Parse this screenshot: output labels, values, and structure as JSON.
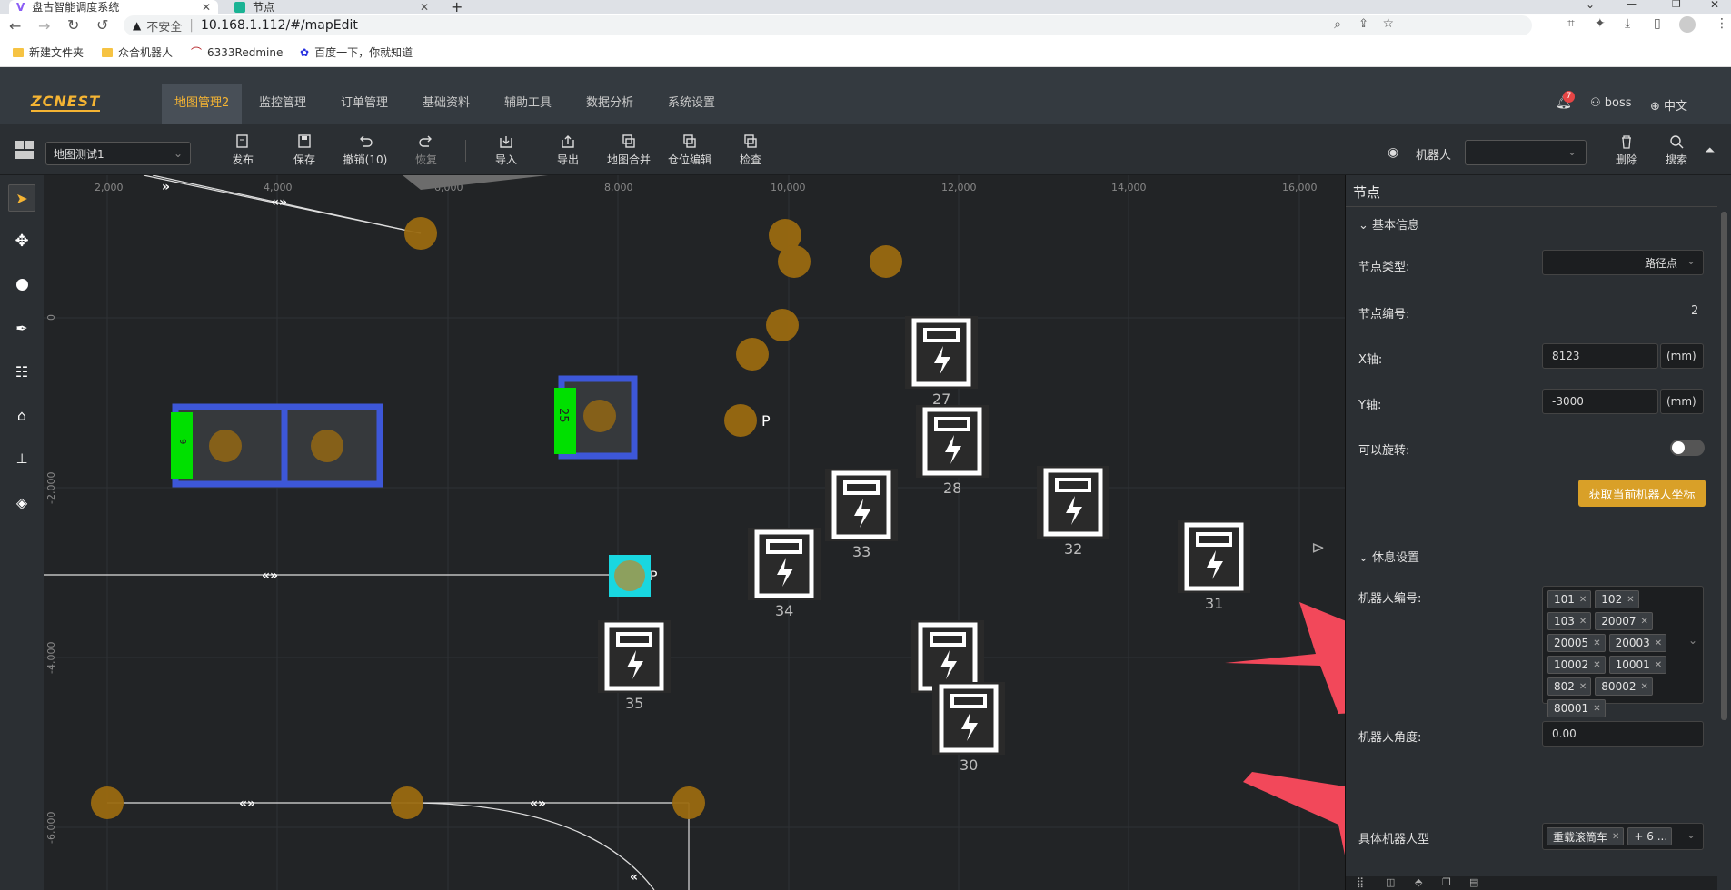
{
  "browser": {
    "tabs": [
      {
        "label": "盘古智能调度系统",
        "active": true
      },
      {
        "label": "节点",
        "active": false
      }
    ],
    "insecure_label": "不安全",
    "url": "10.168.1.112/#/mapEdit",
    "bookmarks": [
      "新建文件夹",
      "众合机器人",
      "6333Redmine",
      "百度一下，你就知道"
    ]
  },
  "app": {
    "logo": "ZCNEST",
    "nav": [
      "地图管理2",
      "监控管理",
      "订单管理",
      "基础资料",
      "辅助工具",
      "数据分析",
      "系统设置"
    ],
    "notification_count": "7",
    "user": "boss",
    "language": "中文"
  },
  "toolbar": {
    "map_select": "地图测试1",
    "buttons": [
      "发布",
      "保存",
      "撤销(10)",
      "恢复",
      "导入",
      "导出",
      "地图合并",
      "仓位编辑",
      "检查"
    ],
    "robot_label": "机器人",
    "right_buttons": [
      "删除",
      "搜索"
    ]
  },
  "canvas": {
    "x_ticks": [
      "2,000",
      "4,000",
      "6,000",
      "8,000",
      "10,000",
      "12,000",
      "14,000",
      "16,000"
    ],
    "y_ticks": [
      "0",
      "-2,000",
      "-4,000",
      "-6,000"
    ],
    "chargers": [
      "27",
      "28",
      "33",
      "32",
      "34",
      "31",
      "35",
      "30"
    ],
    "p_label": "P",
    "shelf_labels": [
      "9",
      "25"
    ]
  },
  "panel": {
    "title": "节点",
    "basic_section": "基本信息",
    "node_type_label": "节点类型:",
    "node_type_value": "路径点",
    "node_id_label": "节点编号:",
    "node_id_value": "2",
    "x_label": "X轴:",
    "x_value": "8123",
    "y_label": "Y轴:",
    "y_value": "-3000",
    "unit": "(mm)",
    "rotate_label": "可以旋转:",
    "get_coord_button": "获取当前机器人坐标",
    "rest_section": "休息设置",
    "robot_id_label": "机器人编号:",
    "robot_ids": [
      "101",
      "102",
      "103",
      "20007",
      "20005",
      "20003",
      "10002",
      "10001",
      "802",
      "80002",
      "80001"
    ],
    "robot_angle_label": "机器人角度:",
    "robot_angle_value": "0.00",
    "specific_robot_label": "具体机器人型",
    "specific_robot_tag": "重载滚筒车",
    "specific_robot_more": "+ 6 ..."
  }
}
